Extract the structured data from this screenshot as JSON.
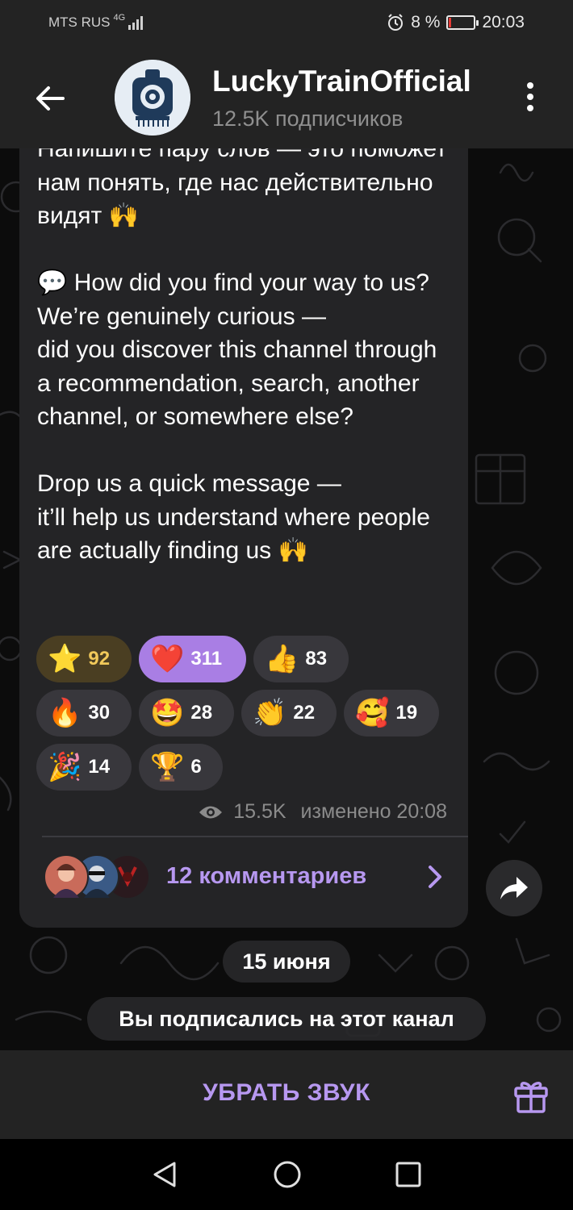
{
  "status_bar": {
    "carrier": "MTS RUS",
    "network": "4G",
    "battery": "8 %",
    "battery_level": 0.08,
    "time": "20:03"
  },
  "header": {
    "title": "LuckyTrainOfficial",
    "subtitle": "12.5K подписчиков"
  },
  "message": {
    "text": "Напишите пару слов — это поможет нам понять, где нас действительно видят 🙌\n\n💬 How did you find your way to us?\nWe’re genuinely curious —\ndid you discover this channel through a recommendation, search, another channel, or somewhere else?\n\nDrop us a quick message —\nit’ll help us understand where people are actually finding us 🙌",
    "reactions": [
      {
        "emoji": "⭐",
        "count": "92",
        "kind": "star"
      },
      {
        "emoji": "❤️",
        "count": "311",
        "kind": "heart"
      },
      {
        "emoji": "👍",
        "count": "83",
        "kind": "normal"
      },
      {
        "emoji": "🔥",
        "count": "30",
        "kind": "normal"
      },
      {
        "emoji": "🤩",
        "count": "28",
        "kind": "normal"
      },
      {
        "emoji": "👏",
        "count": "22",
        "kind": "normal"
      },
      {
        "emoji": "🥰",
        "count": "19",
        "kind": "normal"
      },
      {
        "emoji": "🎉",
        "count": "14",
        "kind": "normal"
      },
      {
        "emoji": "🏆",
        "count": "6",
        "kind": "normal"
      }
    ],
    "views": "15.5K",
    "edited": "изменено 20:08",
    "comments_label": "12 комментариев"
  },
  "date_pill": "15 июня",
  "system_message": "Вы подписались на этот канал",
  "bottom_bar": {
    "mute_label": "УБРАТЬ ЗВУК"
  },
  "colors": {
    "accent": "#b798f0",
    "bubble": "#242426",
    "bars": "#232323"
  },
  "icons": [
    "back-arrow-icon",
    "more-icon",
    "eye-icon",
    "chevron-right-icon",
    "share-icon",
    "gift-icon",
    "nav-back-icon",
    "nav-home-icon",
    "nav-recents-icon"
  ]
}
